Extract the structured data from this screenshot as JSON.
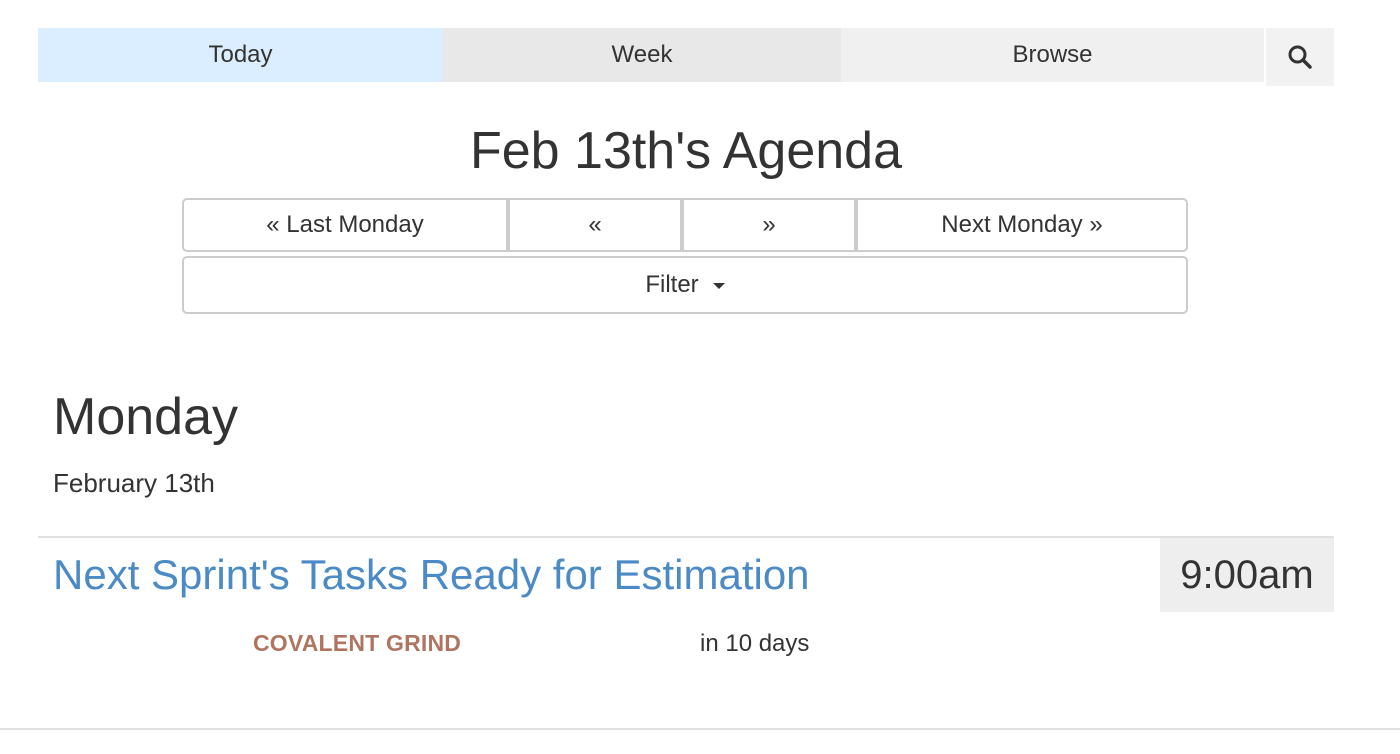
{
  "nav": {
    "tabs": [
      {
        "label": "Today",
        "active": true
      },
      {
        "label": "Week",
        "active": false
      },
      {
        "label": "Browse",
        "active": false
      }
    ],
    "search_icon": "search-icon"
  },
  "page": {
    "title": "Feb 13th's Agenda"
  },
  "pager": {
    "last_monday": "« Last Monday",
    "prev": "«",
    "next": "»",
    "next_monday": "Next Monday »"
  },
  "filter": {
    "label": "Filter"
  },
  "day": {
    "heading": "Monday",
    "date": "February 13th"
  },
  "event": {
    "title": "Next Sprint's Tasks Ready for Estimation",
    "time": "9:00am",
    "organization": "COVALENT GRIND",
    "relative": "in 10 days"
  },
  "colors": {
    "active_tab": "#dbeeff",
    "link": "#4a8ac6",
    "organization": "#b07561",
    "time_bg": "#eeeeee"
  }
}
